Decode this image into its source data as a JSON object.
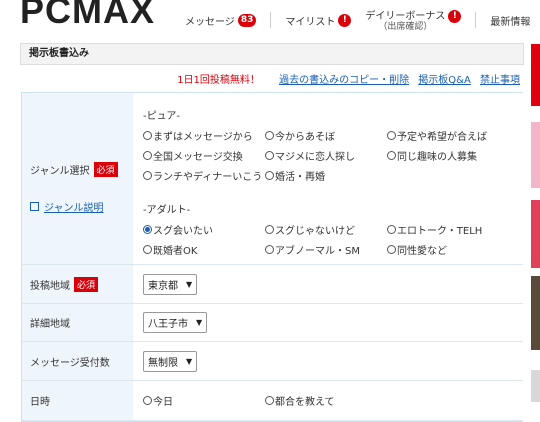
{
  "header": {
    "logo": "PCMAX",
    "nav": {
      "messages": "メッセージ",
      "messages_count": "83",
      "mylist": "マイリスト",
      "mylist_alert": "!",
      "daily_bonus": "デイリーボーナス",
      "daily_bonus_sub": "（出席確認）",
      "daily_alert": "!",
      "news": "最新情報"
    }
  },
  "panel": {
    "title": "掲示板書込み",
    "free_text": "1日1回投稿無料！",
    "links": [
      "過去の書込みのコピー・削除",
      "掲示板Q&A",
      "禁止事項"
    ]
  },
  "genre": {
    "label": "ジャンル選択",
    "required": "必須",
    "help_link": "ジャンル説明",
    "pure_title": "-ピュア-",
    "pure_options": [
      "まずはメッセージから",
      "今からあそぼ",
      "予定や希望が合えば",
      "全国メッセージ交換",
      "マジメに恋人探し",
      "同じ趣味の人募集",
      "ランチやディナーいこう",
      "婚活・再婚"
    ],
    "adult_title": "-アダルト-",
    "adult_options": [
      "スグ会いたい",
      "スグじゃないけど",
      "エロトーク・TELH",
      "既婚者OK",
      "アブノーマル・SM",
      "同性愛など"
    ],
    "selected": "スグ会いたい"
  },
  "area": {
    "label": "投稿地域",
    "required": "必須",
    "value": "東京都"
  },
  "detail_area": {
    "label": "詳細地域",
    "value": "八王子市"
  },
  "msg_limit": {
    "label": "メッセージ受付数",
    "value": "無制限"
  },
  "datetime": {
    "label": "日時",
    "options": [
      "今日",
      "都合を教えて"
    ]
  },
  "colors": {
    "accent_red": "#d9000a",
    "link_blue": "#1a5fb4"
  }
}
